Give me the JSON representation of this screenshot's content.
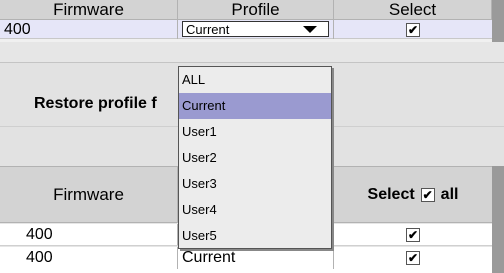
{
  "top_table": {
    "columns": [
      "Firmware",
      "Profile",
      "Select"
    ],
    "row": {
      "firmware": "400",
      "profile": "Current",
      "select": true
    }
  },
  "dropdown": {
    "options": [
      "ALL",
      "Current",
      "User1",
      "User2",
      "User3",
      "User4",
      "User5"
    ],
    "highlighted_index": 1
  },
  "restore_label": "Restore profile f",
  "bottom_table": {
    "columns": [
      "Firmware",
      "Select",
      "all"
    ],
    "select_all_checked": true,
    "rows": [
      {
        "firmware": "400",
        "profile": "",
        "select": true
      },
      {
        "firmware": "400",
        "profile": "Current",
        "select": true
      }
    ]
  },
  "colors": {
    "row_highlight": "#e6e6f8",
    "option_highlight": "#9a9ad0"
  }
}
